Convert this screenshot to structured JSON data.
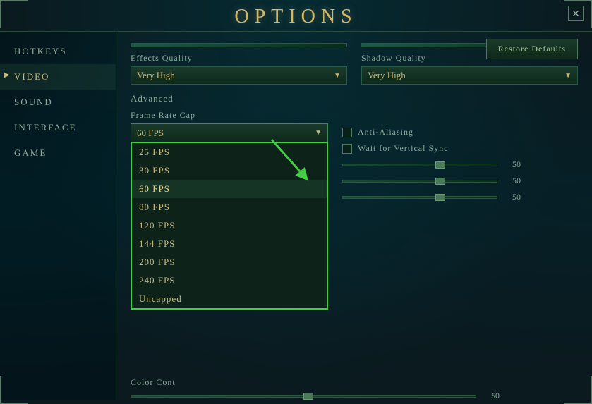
{
  "title": "OPTIONS",
  "close_btn": "✕",
  "sidebar": {
    "items": [
      {
        "id": "hotkeys",
        "label": "HOTKEYS",
        "active": false
      },
      {
        "id": "video",
        "label": "VIDEO",
        "active": true
      },
      {
        "id": "sound",
        "label": "SOUND",
        "active": false
      },
      {
        "id": "interface",
        "label": "INTERFACE",
        "active": false
      },
      {
        "id": "game",
        "label": "GAME",
        "active": false
      }
    ]
  },
  "content": {
    "restore_btn": "Restore Defaults",
    "effects_quality_label": "Effects Quality",
    "effects_quality_value": "Very High",
    "shadow_quality_label": "Shadow Quality",
    "shadow_quality_value": "Very High",
    "advanced_label": "Advanced",
    "frame_rate_label": "Frame Rate Cap",
    "frame_rate_selected": "60 FPS",
    "dropdown_items": [
      {
        "value": "25 FPS",
        "selected": false
      },
      {
        "value": "30 FPS",
        "selected": false
      },
      {
        "value": "60 FPS",
        "selected": true
      },
      {
        "value": "80 FPS",
        "selected": false
      },
      {
        "value": "120 FPS",
        "selected": false
      },
      {
        "value": "144 FPS",
        "selected": false
      },
      {
        "value": "200 FPS",
        "selected": false
      },
      {
        "value": "240 FPS",
        "selected": false
      },
      {
        "value": "Uncapped",
        "selected": false
      }
    ],
    "anti_aliasing_label": "Anti-Aliasing",
    "vsync_label": "Wait for Vertical Sync",
    "slider_value_1": "50",
    "slider_value_2": "50",
    "slider_value_3": "50",
    "color_control_label": "Color Cont",
    "slider_value_4": "50"
  }
}
